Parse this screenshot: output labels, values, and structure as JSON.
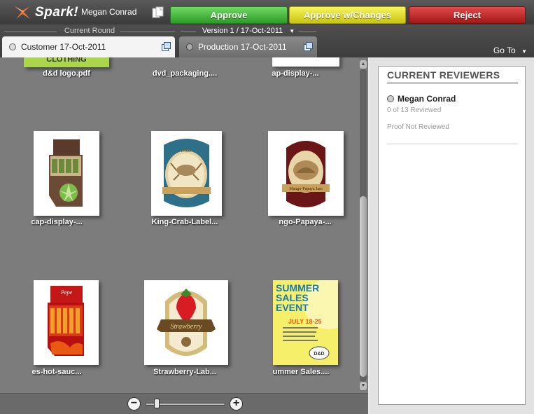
{
  "topbar": {
    "logo_text": "Spark!",
    "user": "Megan Conrad",
    "approve_label": "Approve",
    "approve_changes_label": "Approve w/Changes",
    "reject_label": "Reject",
    "colors": {
      "approve": "#3fb535",
      "approve_changes": "#e4de2a",
      "reject": "#c42828"
    }
  },
  "rounds": {
    "current_round_label": "Current Round",
    "version_label": "Version 1 / 17-Oct-2011",
    "tabs": [
      {
        "label": "Customer 17-Oct-2011",
        "active": true
      },
      {
        "label": "Production 17-Oct-2011",
        "active": false
      }
    ],
    "goto_label": "Go To"
  },
  "files": [
    {
      "name": "d&d logo.pdf",
      "thumb": "logo-clothing"
    },
    {
      "name": "dvd_packaging....",
      "thumb": "blank"
    },
    {
      "name": "ap-display-...",
      "thumb": "blank"
    },
    {
      "name": "cap-display-...",
      "thumb": "cap-display"
    },
    {
      "name": "King-Crab-Label...",
      "thumb": "crab-label"
    },
    {
      "name": "ngo-Papaya-...",
      "thumb": "papaya-label"
    },
    {
      "name": "es-hot-sauc...",
      "thumb": "hot-sauce-display"
    },
    {
      "name": "Strawberry-Lab...",
      "thumb": "strawberry-label"
    },
    {
      "name": "ummer Sales....",
      "thumb": "summer-sales"
    }
  ],
  "thumb_text": {
    "clothing": "CLOTHING",
    "crab_label_brand": "D&D",
    "papaya_label_text": "Mango-Papaya Jam",
    "strawberry_label_text": "Strawberry",
    "hot_sauce_brand": "Pepe",
    "summer": {
      "line1": "SUMMER",
      "line2": "SALES",
      "line3": "EVENT",
      "dates": "JULY 18-25",
      "brand": "D&D"
    }
  },
  "zoom": {
    "out_label": "−",
    "in_label": "+",
    "level": 0.12
  },
  "reviewers": {
    "title": "CURRENT REVIEWERS",
    "items": [
      {
        "name": "Megan Conrad",
        "count": "0 of 13 Reviewed",
        "status": "Proof Not Reviewed"
      }
    ]
  }
}
